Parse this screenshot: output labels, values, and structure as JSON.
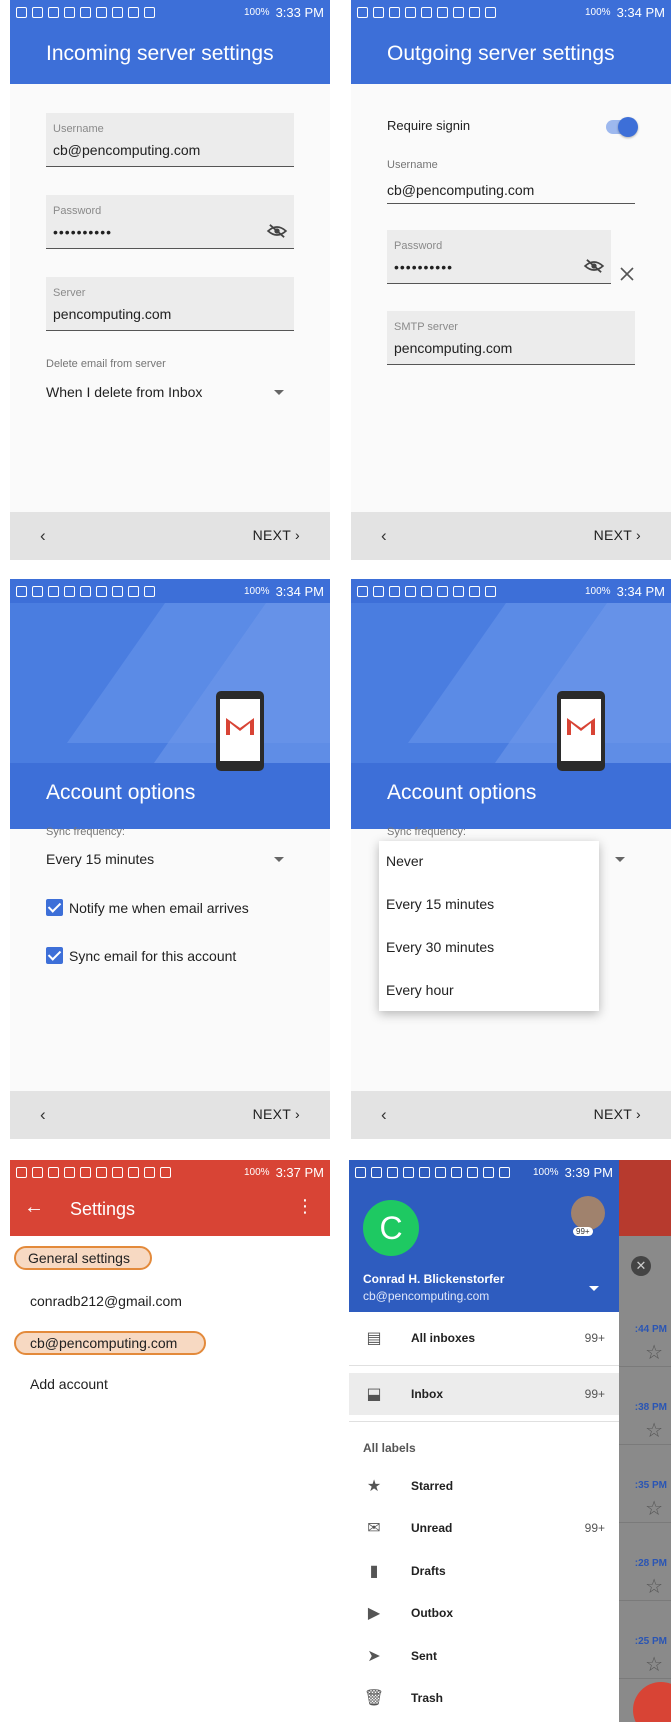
{
  "panel1": {
    "status_time": "3:33 PM",
    "battery": "100%",
    "title": "Incoming server settings",
    "username_label": "Username",
    "username_value": "cb@pencomputing.com",
    "password_label": "Password",
    "password_value": "••••••••••",
    "server_label": "Server",
    "server_value": "pencomputing.com",
    "delete_label": "Delete email from server",
    "delete_value": "When I delete from Inbox",
    "back": "‹",
    "next": "NEXT ›"
  },
  "panel2": {
    "status_time": "3:34 PM",
    "battery": "100%",
    "title": "Outgoing server settings",
    "require_signin": "Require signin",
    "username_label": "Username",
    "username_value": "cb@pencomputing.com",
    "password_label": "Password",
    "password_value": "••••••••••",
    "smtp_label": "SMTP server",
    "smtp_value": "pencomputing.com",
    "back": "‹",
    "next": "NEXT ›"
  },
  "panel3": {
    "status_time": "3:34 PM",
    "battery": "100%",
    "title": "Account options",
    "sync_label": "Sync frequency:",
    "sync_value": "Every 15 minutes",
    "notify": "Notify me when email arrives",
    "sync_email": "Sync email for this account",
    "back": "‹",
    "next": "NEXT ›"
  },
  "panel4": {
    "status_time": "3:34 PM",
    "battery": "100%",
    "title": "Account options",
    "sync_label": "Sync frequency:",
    "options": [
      "Never",
      "Every 15 minutes",
      "Every 30 minutes",
      "Every hour"
    ],
    "back": "‹",
    "next": "NEXT ›"
  },
  "panel5": {
    "status_time": "3:37 PM",
    "battery": "100%",
    "title": "Settings",
    "items": [
      "General settings",
      "conradb212@gmail.com",
      "cb@pencomputing.com",
      "Add account"
    ]
  },
  "panel6": {
    "status_time": "3:39 PM",
    "battery": "100%",
    "avatar_letter": "C",
    "badge": "99+",
    "name": "Conrad H. Blickenstorfer",
    "email": "cb@pencomputing.com",
    "all_labels": "All labels",
    "items": [
      {
        "label": "All inboxes",
        "count": "99+"
      },
      {
        "label": "Inbox",
        "count": "99+"
      },
      {
        "label": "Starred",
        "count": ""
      },
      {
        "label": "Unread",
        "count": "99+"
      },
      {
        "label": "Drafts",
        "count": ""
      },
      {
        "label": "Outbox",
        "count": ""
      },
      {
        "label": "Sent",
        "count": ""
      },
      {
        "label": "Trash",
        "count": ""
      }
    ],
    "times": [
      ":44 PM",
      ":38 PM",
      ":35 PM",
      ":28 PM",
      ":25 PM"
    ]
  },
  "colors": {
    "blue": "#3d6fd8",
    "red": "#d84435",
    "green_avatar": "#1ec962",
    "highlight": "#e38a3b"
  }
}
